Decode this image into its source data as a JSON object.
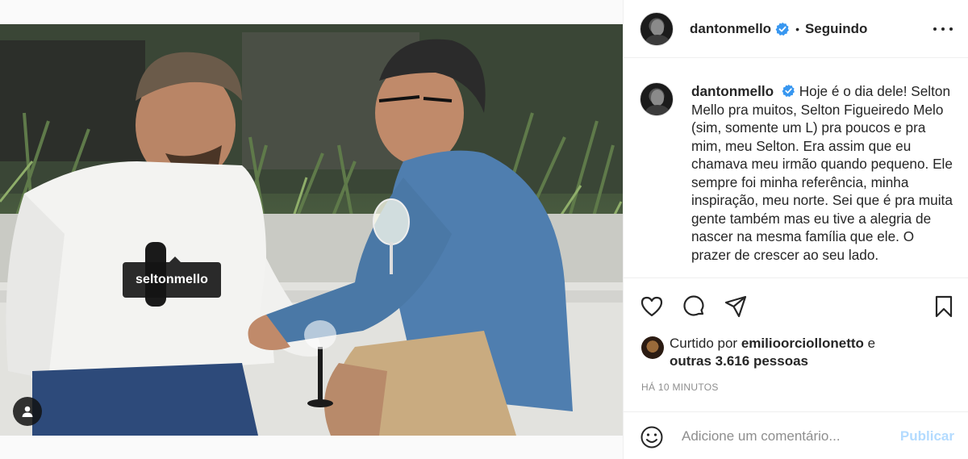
{
  "post": {
    "author": "dantonmello",
    "verified_icon": "verified-badge-icon",
    "separator": "•",
    "follow_status": "Seguindo",
    "more_icon": "more-options-icon",
    "photo_tag": "seltonmello",
    "caption": "Hoje é o dia dele! Selton Mello pra muitos, Selton Figueiredo Melo (sim, somente um L) pra poucos e pra mim, meu Selton. Era assim que eu chamava meu irmão quando pequeno. Ele sempre foi minha referência, minha inspiração, meu norte. Sei que é pra muita gente também mas eu tive a alegria de nascer na mesma família que ele. O prazer de crescer ao seu lado.",
    "liked_prefix": "Curtido por",
    "liked_user": "emilioorciollonetto",
    "liked_and": "e",
    "liked_others": "outras 3.616 pessoas",
    "time": "HÁ 10 MINUTOS"
  },
  "comment": {
    "placeholder": "Adicione um comentário...",
    "publish_label": "Publicar"
  },
  "colors": {
    "verified": "#3897f0",
    "publish_disabled": "#b3dbff",
    "muted": "#8e8e8e",
    "border": "#efefef"
  }
}
